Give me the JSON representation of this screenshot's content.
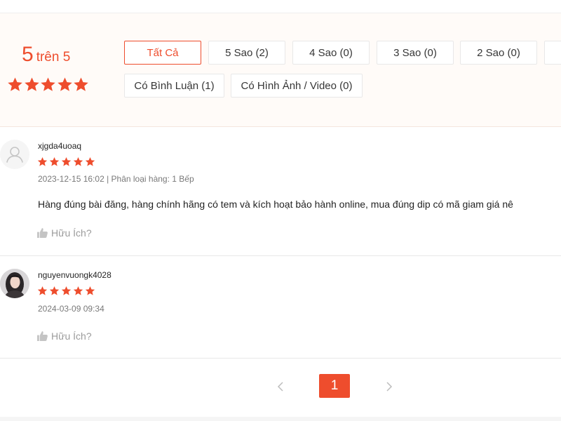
{
  "colors": {
    "accent": "#ee4d2d",
    "overview_bg": "#fffbf8"
  },
  "rating": {
    "score": "5",
    "out_of": "trên 5",
    "stars": 5
  },
  "filters": [
    {
      "label": "Tất Cả",
      "active": true
    },
    {
      "label": "5 Sao (2)",
      "active": false
    },
    {
      "label": "4 Sao (0)",
      "active": false
    },
    {
      "label": "3 Sao (0)",
      "active": false
    },
    {
      "label": "2 Sao (0)",
      "active": false
    },
    {
      "label": "",
      "active": false
    },
    {
      "label": "Có Bình Luận (1)",
      "active": false
    },
    {
      "label": "Có Hình Ảnh / Video (0)",
      "active": false
    }
  ],
  "reviews": [
    {
      "username": "xjgda4uoaq",
      "stars": 5,
      "meta": "2023-12-15 16:02 | Phân loại hàng: 1 Bếp",
      "content": "Hàng đúng bài đăng, hàng chính hãng có tem và kích hoạt bảo hành online, mua đúng dip có mã giam giá nê",
      "helpful_label": "Hữu Ích?",
      "helpful_icon": "thumbs-up-icon",
      "avatar_icon": "user-placeholder-icon"
    },
    {
      "username": "nguyenvuongk4028",
      "stars": 5,
      "meta": "2024-03-09 09:34",
      "content": "",
      "helpful_label": "Hữu Ích?",
      "helpful_icon": "thumbs-up-icon",
      "avatar_icon": "user-photo"
    }
  ],
  "pagination": {
    "current_page": "1",
    "prev_icon": "chevron-left-icon",
    "next_icon": "chevron-right-icon"
  }
}
